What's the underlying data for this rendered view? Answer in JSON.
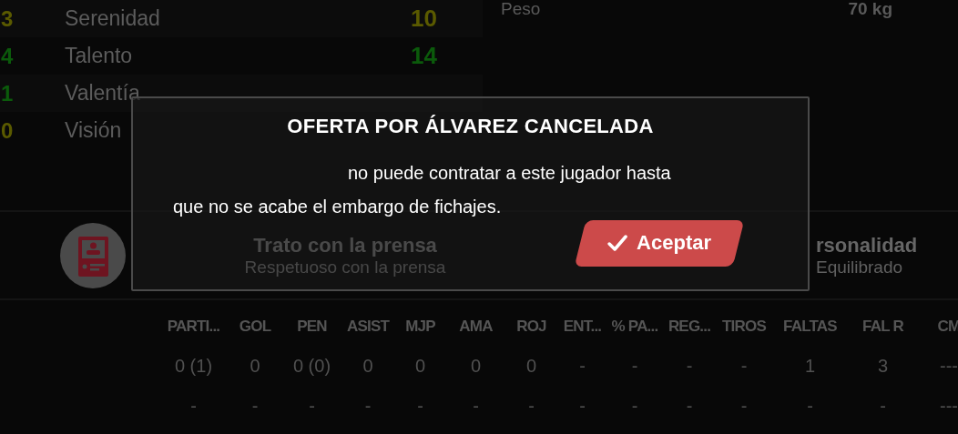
{
  "attributes": [
    {
      "prev": {
        "value": "3",
        "color": "#5a5a00"
      },
      "name": "Serenidad",
      "value": "10",
      "color": "#5a5a00"
    },
    {
      "prev": {
        "value": "4",
        "color": "#0b5a0b"
      },
      "name": "Talento",
      "value": "14",
      "color": "#0b5a0b"
    },
    {
      "prev": {
        "value": "1",
        "color": "#0b5a0b"
      },
      "name": "Valentía"
    },
    {
      "prev": {
        "value": "0",
        "color": "#5a5a00"
      },
      "name": "Visión"
    }
  ],
  "details": [
    {
      "label": "Peso",
      "value": "70 kg"
    }
  ],
  "traits": [
    {
      "title": "Trato con la prensa",
      "value": "Respetuoso con la prensa"
    },
    {
      "title": "rsonalidad",
      "value": "Equilibrado"
    }
  ],
  "stats_table": {
    "columns": [
      "PARTI...",
      "GOL",
      "PEN",
      "ASIST",
      "MJP",
      "AMA",
      "ROJ",
      "ENT...",
      "% PA...",
      "REG...",
      "TIROS",
      "FALTAS",
      "FAL R",
      "CM"
    ],
    "rows": [
      [
        "0 (1)",
        "0",
        "0 (0)",
        "0",
        "0",
        "0",
        "0",
        "-",
        "-",
        "-",
        "-",
        "1",
        "3",
        "---"
      ],
      [
        "-",
        "-",
        "-",
        "-",
        "-",
        "-",
        "-",
        "-",
        "-",
        "-",
        "-",
        "-",
        "-",
        "---"
      ]
    ]
  },
  "dialog": {
    "title": "OFERTA POR ÁLVAREZ CANCELADA",
    "message": "no puede contratar a este jugador hasta que no se acabe el embargo de fichajes.",
    "button": "Aceptar"
  }
}
